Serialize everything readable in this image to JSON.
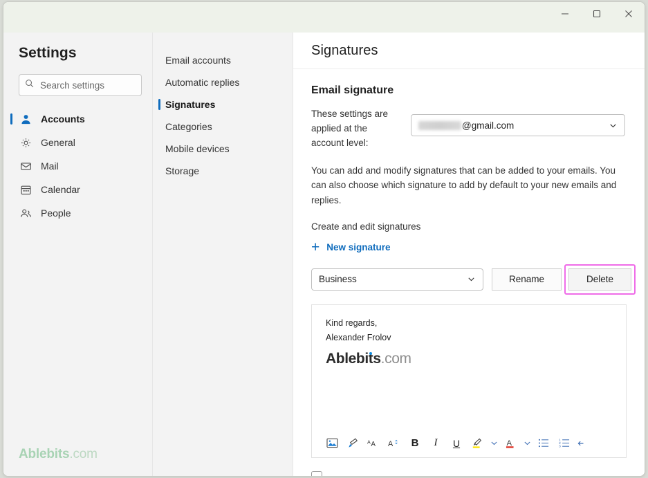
{
  "window": {
    "controls": [
      {
        "name": "minimize-button",
        "glyph": "minimize"
      },
      {
        "name": "maximize-button",
        "glyph": "maximize"
      },
      {
        "name": "close-button",
        "glyph": "close"
      }
    ]
  },
  "sidebar": {
    "title": "Settings",
    "search": {
      "placeholder": "Search settings",
      "value": "",
      "icon": "search-icon"
    },
    "items": [
      {
        "label": "Accounts",
        "icon": "person-icon",
        "active": true
      },
      {
        "label": "General",
        "icon": "gear-icon",
        "active": false
      },
      {
        "label": "Mail",
        "icon": "envelope-icon",
        "active": false
      },
      {
        "label": "Calendar",
        "icon": "calendar-icon",
        "active": false
      },
      {
        "label": "People",
        "icon": "people-icon",
        "active": false
      }
    ],
    "watermark": {
      "brand": "Ablebits",
      "tld": ".com"
    }
  },
  "midnav": {
    "items": [
      {
        "label": "Email accounts",
        "active": false
      },
      {
        "label": "Automatic replies",
        "active": false
      },
      {
        "label": "Signatures",
        "active": true
      },
      {
        "label": "Categories",
        "active": false
      },
      {
        "label": "Mobile devices",
        "active": false
      },
      {
        "label": "Storage",
        "active": false
      }
    ]
  },
  "main": {
    "header_title": "Signatures",
    "section_title": "Email signature",
    "account_label": "These settings are applied at the account level:",
    "account_value_suffix": "@gmail.com",
    "account_value_redacted": true,
    "description": "You can add and modify signatures that can be added to your emails. You can also choose which signature to add by default to your new emails and replies.",
    "create_edit_label": "Create and edit signatures",
    "new_signature_label": "New signature",
    "new_signature_icon": "plus-icon",
    "signature_selected": "Business",
    "rename_label": "Rename",
    "delete_label": "Delete",
    "delete_highlight_color": "#ef6ce8",
    "accent_color": "#0f6cbd",
    "editor": {
      "line1": "Kind regards,",
      "line2": "Alexander Frolov",
      "logo_brand": "Ablebits",
      "logo_tld": ".com",
      "toolbar": [
        {
          "name": "insert-picture-icon",
          "kind": "picture"
        },
        {
          "name": "format-painter-icon",
          "kind": "painter"
        },
        {
          "name": "font-icon",
          "kind": "font"
        },
        {
          "name": "font-size-icon",
          "kind": "fontsize"
        },
        {
          "name": "bold-button",
          "kind": "bold",
          "label": "B"
        },
        {
          "name": "italic-button",
          "kind": "italic",
          "label": "I"
        },
        {
          "name": "underline-button",
          "kind": "underline",
          "label": "U"
        },
        {
          "name": "highlight-color-icon",
          "kind": "highlight",
          "color": "#ffe600"
        },
        {
          "name": "highlight-color-caret-icon",
          "kind": "caret"
        },
        {
          "name": "font-color-icon",
          "kind": "fontcolor",
          "color": "#e03b2f"
        },
        {
          "name": "font-color-caret-icon",
          "kind": "caret"
        },
        {
          "name": "bullet-list-icon",
          "kind": "bullets"
        },
        {
          "name": "numbered-list-icon",
          "kind": "numbers"
        },
        {
          "name": "more-formatting-icon",
          "kind": "more"
        }
      ]
    },
    "scrollbar": {
      "position_pct": 3,
      "thumb_pct": 76
    }
  }
}
